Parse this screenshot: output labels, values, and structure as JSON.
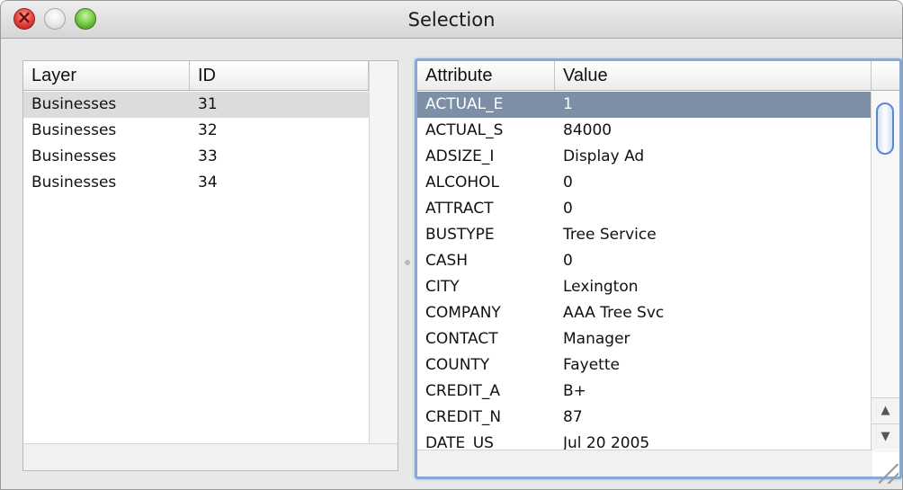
{
  "window": {
    "title": "Selection"
  },
  "left_table": {
    "columns": [
      "Layer",
      "ID"
    ],
    "rows": [
      [
        "Businesses",
        "31"
      ],
      [
        "Businesses",
        "32"
      ],
      [
        "Businesses",
        "33"
      ],
      [
        "Businesses",
        "34"
      ]
    ]
  },
  "right_table": {
    "columns": [
      "Attribute",
      "Value"
    ],
    "rows": [
      [
        "ACTUAL_E",
        "1"
      ],
      [
        "ACTUAL_S",
        "84000"
      ],
      [
        "ADSIZE_I",
        "Display Ad"
      ],
      [
        "ALCOHOL",
        "0"
      ],
      [
        "ATTRACT",
        "0"
      ],
      [
        "BUSTYPE",
        "Tree Service"
      ],
      [
        "CASH",
        "0"
      ],
      [
        "CITY",
        "Lexington"
      ],
      [
        "COMPANY",
        "AAA Tree Svc"
      ],
      [
        "CONTACT",
        "Manager"
      ],
      [
        "COUNTY",
        "Fayette"
      ],
      [
        "CREDIT_A",
        "B+"
      ],
      [
        "CREDIT_N",
        "87"
      ],
      [
        "DATE_US",
        "Jul 20 2005"
      ]
    ]
  },
  "icons": {
    "close": "close-icon",
    "minimize": "minimize-icon",
    "zoom": "zoom-icon",
    "scroll_up": "chevron-up-icon",
    "scroll_down": "chevron-down-icon",
    "resize": "resize-grip-icon"
  },
  "colors": {
    "selection_blue": "#7d8ea7",
    "selection_grey": "#dcdcdc",
    "focus_ring": "#87a9d6"
  }
}
